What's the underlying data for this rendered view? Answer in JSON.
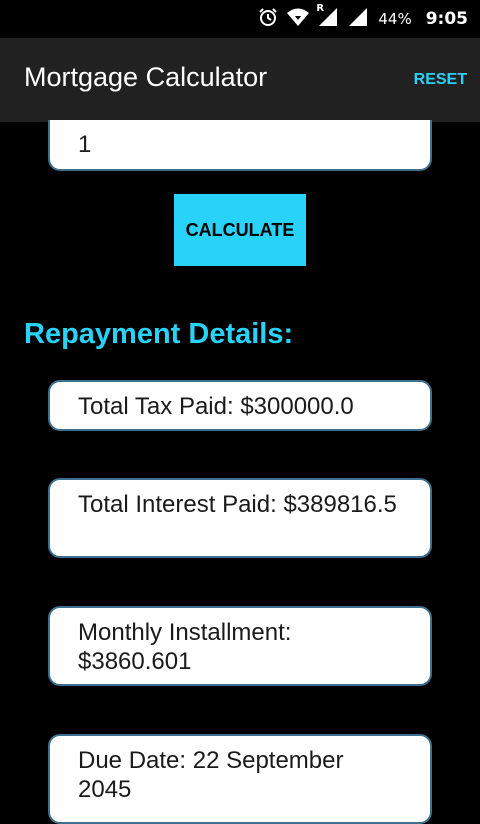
{
  "status_bar": {
    "alarm_icon": "alarm-clock-icon",
    "wifi_icon": "wifi-icon",
    "signal_icon": "cell-signal-icon",
    "roaming_label": "R",
    "battery_percent": "44%",
    "time": "9:05"
  },
  "app_bar": {
    "title": "Mortgage Calculator",
    "reset_label": "RESET"
  },
  "form": {
    "input_value": "1",
    "calculate_label": "CALCULATE"
  },
  "results": {
    "heading": "Repayment Details:",
    "total_tax": "Total Tax Paid: $300000.0",
    "total_interest": "Total Interest Paid: $389816.5",
    "monthly_installment": "Monthly Installment: $3860.601",
    "due_date": "Due Date: 22 September 2045"
  },
  "colors": {
    "accent": "#29d2f8",
    "app_bar": "#212121",
    "background": "#000000",
    "field_border": "#3d6f8f"
  }
}
